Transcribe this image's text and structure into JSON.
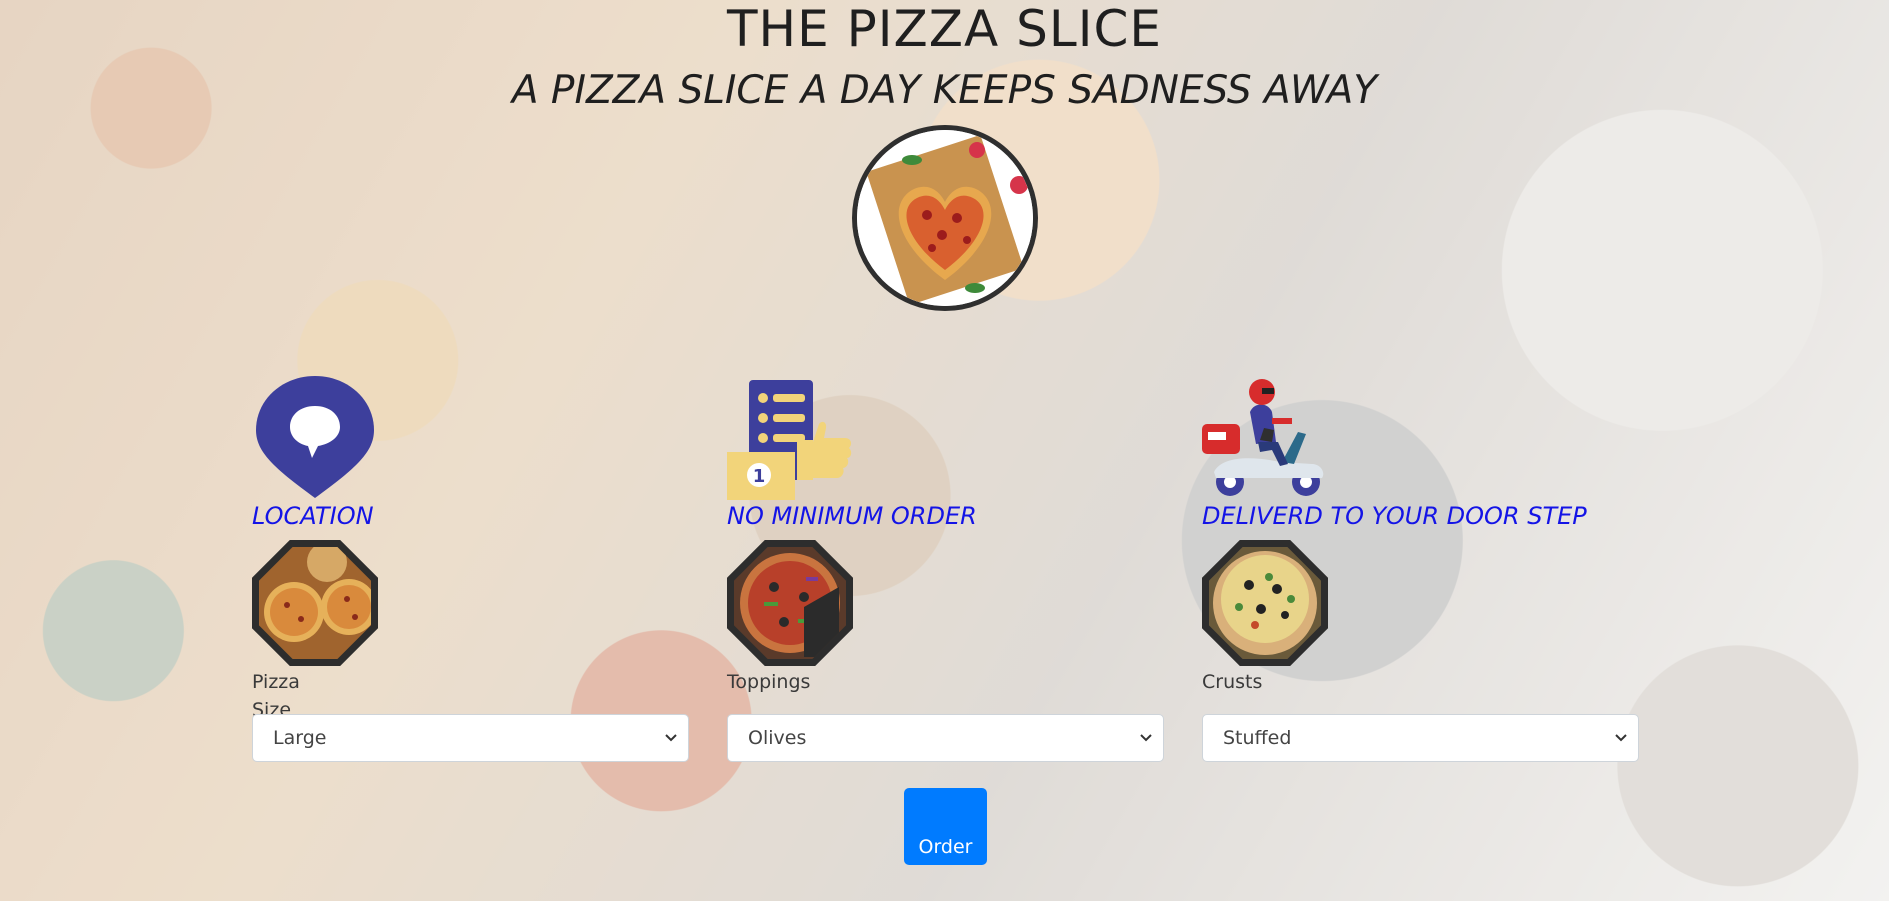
{
  "header": {
    "title": "THE PIZZA SLICE",
    "tagline": "A PIZZA SLICE A DAY KEEPS SADNESS AWAY"
  },
  "features": [
    {
      "title": "LOCATION",
      "icon": "location-pin-icon"
    },
    {
      "title": "NO MINIMUM ORDER",
      "icon": "menu-thumbs-up-icon"
    },
    {
      "title": "DELIVERD TO YOUR DOOR STEP",
      "icon": "delivery-scooter-icon"
    }
  ],
  "options": [
    {
      "label": "Pizza Size",
      "selected": "Large"
    },
    {
      "label": "Toppings",
      "selected": "Olives"
    },
    {
      "label": "Crusts",
      "selected": "Stuffed"
    }
  ],
  "order_button": "Order",
  "colors": {
    "accent": "#007bff",
    "feature_title": "#1414e6",
    "pin": "#3d3f9c"
  }
}
